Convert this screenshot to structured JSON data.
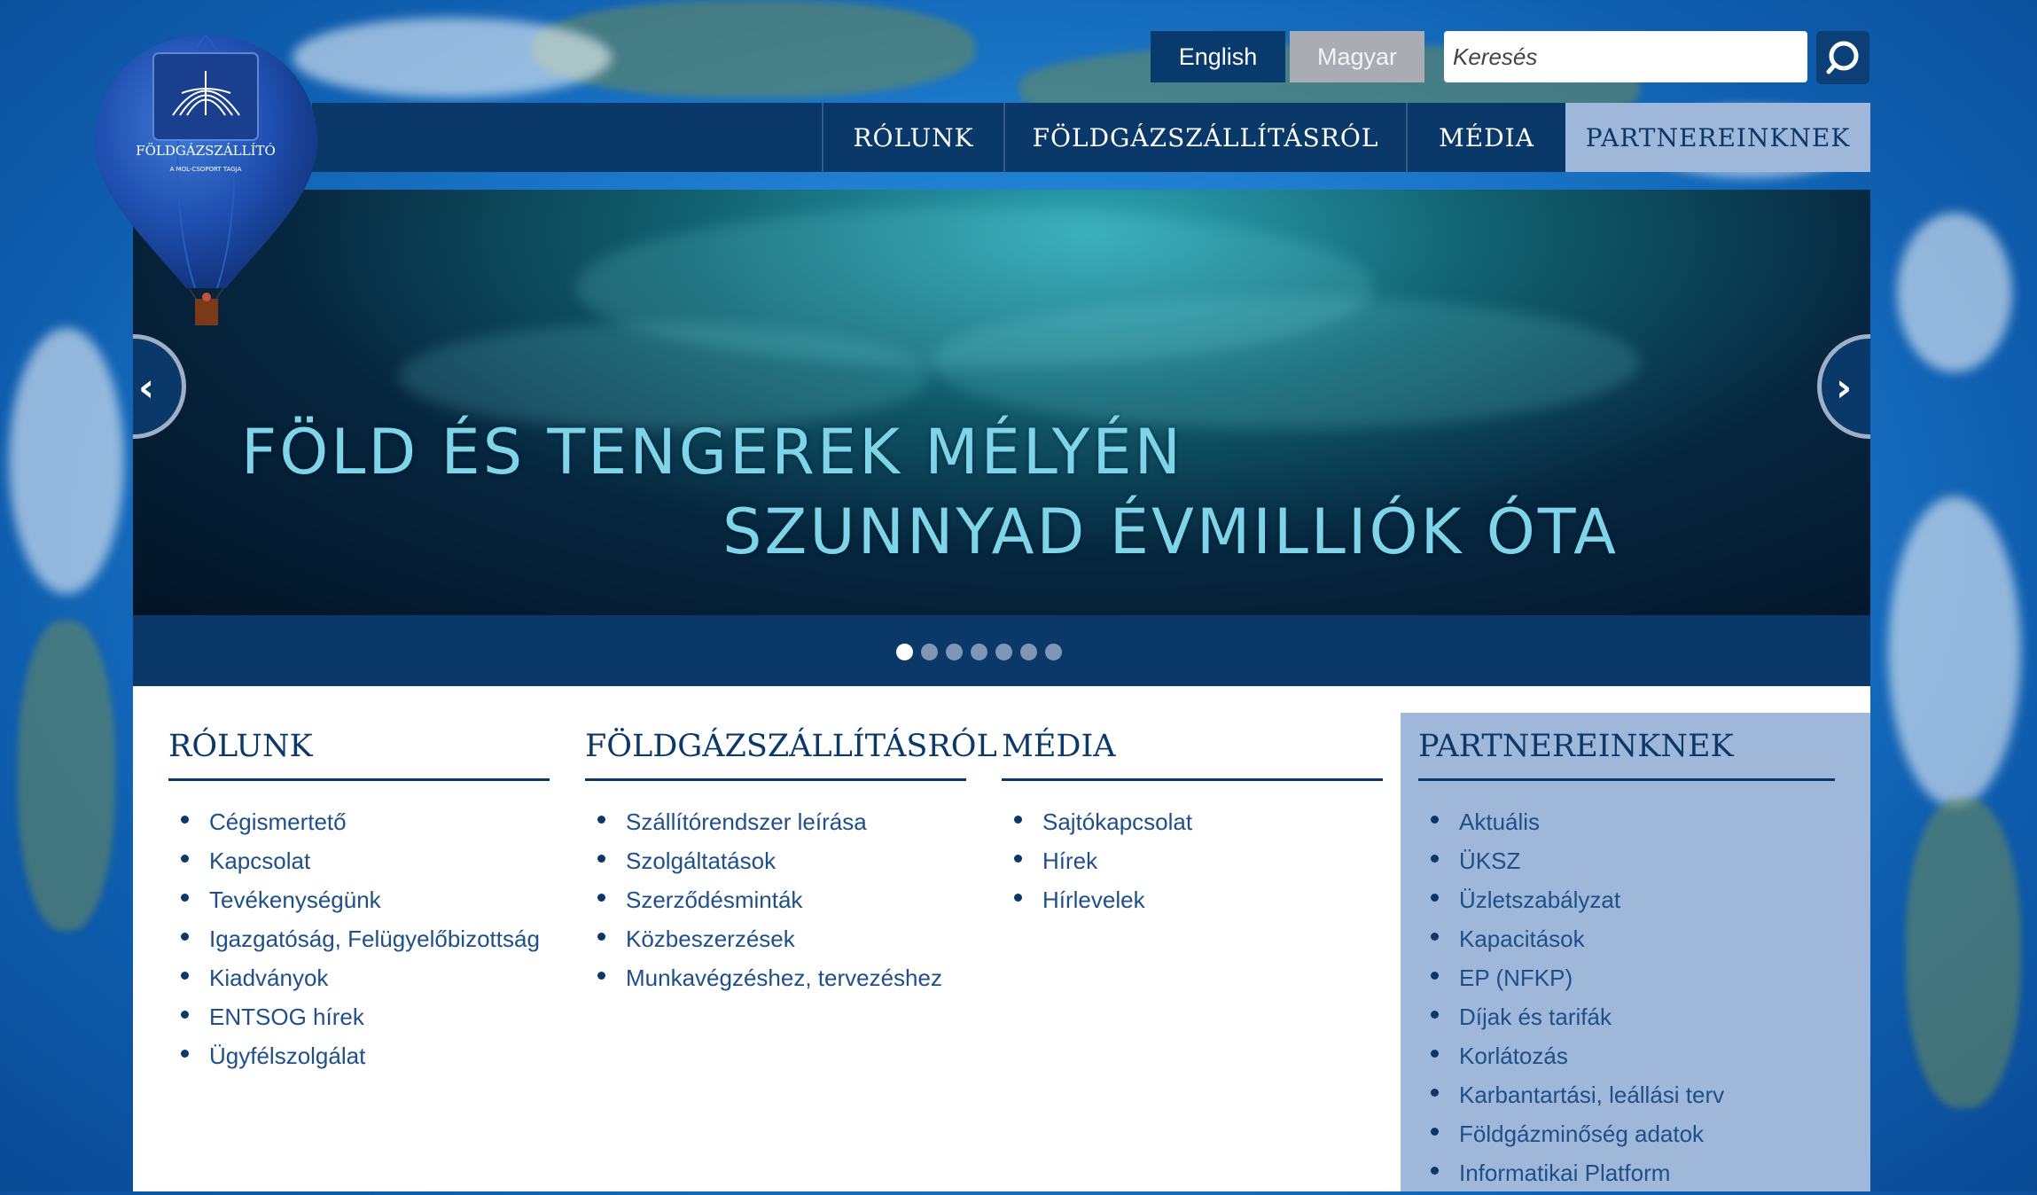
{
  "brand": {
    "logo_text": "FÖLDGÁZSZÁLLÍTÓ",
    "logo_subtext": "A MOL-CSOPORT TAGJA"
  },
  "language": {
    "english": "English",
    "magyar": "Magyar"
  },
  "search": {
    "placeholder": "Keresés"
  },
  "nav": {
    "rolunk": "RÓLUNK",
    "foldgaz": "FÖLDGÁZSZÁLLÍTÁSRÓL",
    "media": "MÉDIA",
    "partner": "PARTNEREINKNEK"
  },
  "slider": {
    "line1": "FÖLD ÉS TENGEREK MÉLYÉN",
    "line2": "SZUNNYAD ÉVMILLIÓK ÓTA",
    "dot_count": 7,
    "active_dot": 1
  },
  "columns": {
    "rolunk": {
      "title": "RÓLUNK",
      "items": [
        "Cégismertető",
        "Kapcsolat",
        "Tevékenységünk",
        "Igazgatóság, Felügyelőbizottság",
        "Kiadványok",
        "ENTSOG hírek",
        "Ügyfélszolgálat"
      ]
    },
    "foldgaz": {
      "title": "FÖLDGÁZSZÁLLÍTÁSRÓL",
      "items": [
        "Szállítórendszer leírása",
        "Szolgáltatások",
        "Szerződésminták",
        "Közbeszerzések",
        "Munkavégzéshez, tervezéshez"
      ]
    },
    "media": {
      "title": "MÉDIA",
      "items": [
        "Sajtókapcsolat",
        "Hírek",
        "Hírlevelek"
      ]
    },
    "partner": {
      "title": "PARTNEREINKNEK",
      "items": [
        "Aktuális",
        "ÜKSZ",
        "Üzletszabályzat",
        "Kapacitások",
        "EP (NFKP)",
        "Díjak és tarifák",
        "Korlátozás",
        "Karbantartási, leállási terv",
        "Földgázminőség adatok",
        "Informatikai Platform"
      ]
    }
  },
  "colors": {
    "navy": "#0a3868",
    "partner_bg": "#9fb8da",
    "link": "#1f4f88",
    "slide_text": "#7ed4e8"
  }
}
